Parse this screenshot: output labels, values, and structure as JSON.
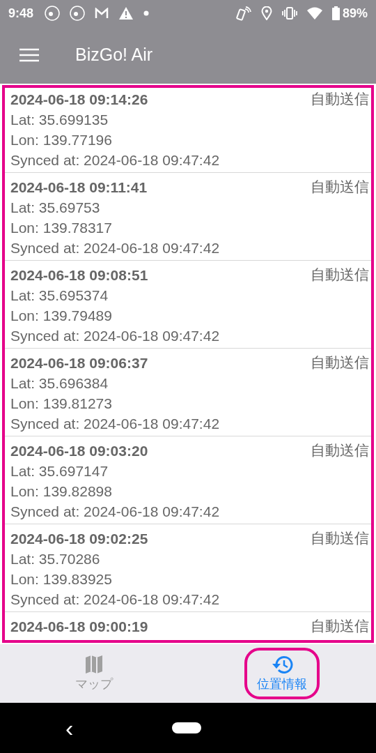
{
  "status_bar": {
    "time": "9:48",
    "battery": "89%"
  },
  "app_bar": {
    "title": "BizGo! Air"
  },
  "records": [
    {
      "timestamp": "2024-06-18 09:14:26",
      "mode": "自動送信",
      "lat": "Lat: 35.699135",
      "lon": "Lon: 139.77196",
      "synced": "Synced at: 2024-06-18 09:47:42"
    },
    {
      "timestamp": "2024-06-18 09:11:41",
      "mode": "自動送信",
      "lat": "Lat: 35.69753",
      "lon": "Lon: 139.78317",
      "synced": "Synced at: 2024-06-18 09:47:42"
    },
    {
      "timestamp": "2024-06-18 09:08:51",
      "mode": "自動送信",
      "lat": "Lat: 35.695374",
      "lon": "Lon: 139.79489",
      "synced": "Synced at: 2024-06-18 09:47:42"
    },
    {
      "timestamp": "2024-06-18 09:06:37",
      "mode": "自動送信",
      "lat": "Lat: 35.696384",
      "lon": "Lon: 139.81273",
      "synced": "Synced at: 2024-06-18 09:47:42"
    },
    {
      "timestamp": "2024-06-18 09:03:20",
      "mode": "自動送信",
      "lat": "Lat: 35.697147",
      "lon": "Lon: 139.82898",
      "synced": "Synced at: 2024-06-18 09:47:42"
    },
    {
      "timestamp": "2024-06-18 09:02:25",
      "mode": "自動送信",
      "lat": "Lat: 35.70286",
      "lon": "Lon: 139.83925",
      "synced": "Synced at: 2024-06-18 09:47:42"
    },
    {
      "timestamp": "2024-06-18 09:00:19",
      "mode": "自動送信"
    }
  ],
  "tabs": [
    {
      "label": "マップ",
      "kind": "map",
      "selected": false
    },
    {
      "label": "位置情報",
      "kind": "history",
      "selected": true
    }
  ],
  "nav_bar": {
    "back": "‹"
  }
}
